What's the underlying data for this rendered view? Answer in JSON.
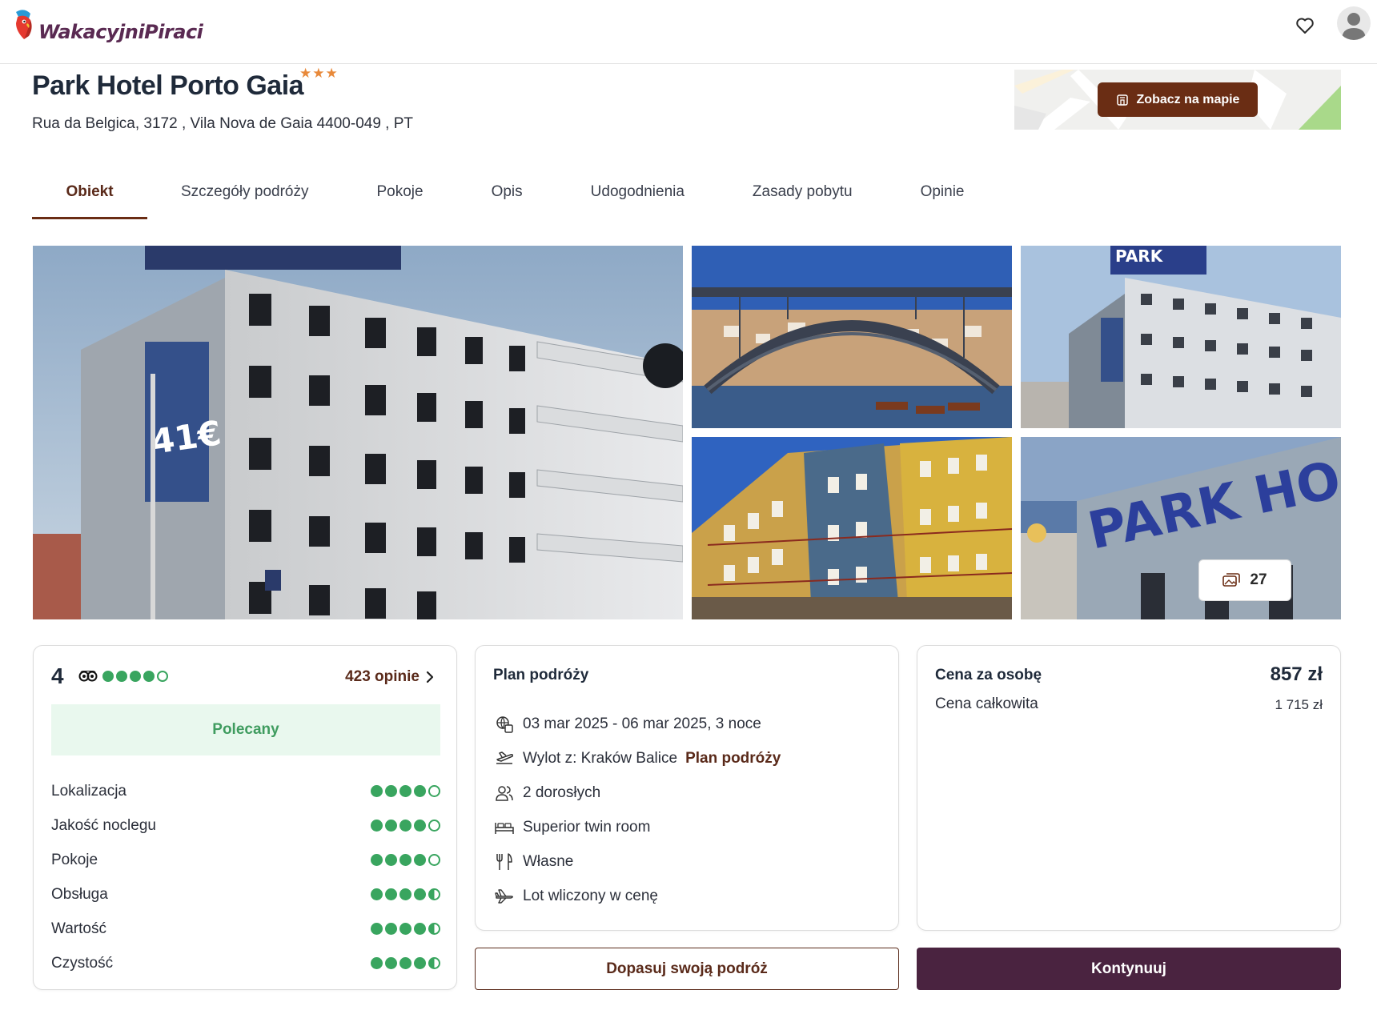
{
  "brand": {
    "name": "WakacyjniPiraci"
  },
  "header": {
    "favorite_icon": "heart-icon",
    "account_icon": "user-icon"
  },
  "hotel": {
    "name": "Park Hotel Porto Gaia",
    "stars_text": "★★★",
    "stars": 3,
    "address": "Rua da Belgica, 3172 , Vila Nova de Gaia 4400-049 , PT",
    "map_button": "Zobacz na mapie"
  },
  "tabs": [
    {
      "label": "Obiekt",
      "active": true
    },
    {
      "label": "Szczegóły podróży"
    },
    {
      "label": "Pokoje"
    },
    {
      "label": "Opis"
    },
    {
      "label": "Udogodnienia"
    },
    {
      "label": "Zasady pobytu"
    },
    {
      "label": "Opinie"
    }
  ],
  "gallery": {
    "photo_count": "27"
  },
  "rating": {
    "score": "4",
    "score_dots": 4,
    "opinions": "423 opinie",
    "badge": "Polecany",
    "criteria": [
      {
        "label": "Lokalizacja",
        "value": 4
      },
      {
        "label": "Jakość noclegu",
        "value": 4
      },
      {
        "label": "Pokoje",
        "value": 4
      },
      {
        "label": "Obsługa",
        "value": 4.5
      },
      {
        "label": "Wartość",
        "value": 4.5
      },
      {
        "label": "Czystość",
        "value": 4.5
      }
    ]
  },
  "plan": {
    "title": "Plan podróży",
    "dates": "03 mar 2025 - 06 mar 2025, 3 noce",
    "departure": "Wylot z: Kraków Balice",
    "departure_link": "Plan podróży",
    "guests": "2 dorosłych",
    "room": "Superior twin room",
    "board": "Własne",
    "flight": "Lot wliczony w cenę"
  },
  "price": {
    "per_person_label": "Cena za osobę",
    "per_person_value": "857 zł",
    "total_label": "Cena całkowita",
    "total_value": "1 715 zł"
  },
  "actions": {
    "adjust": "Dopasuj swoją podróż",
    "continue": "Kontynuuj"
  },
  "colors": {
    "brand_purple": "#4a2340",
    "accent_brown": "#6a2d14",
    "rating_green": "#39a55f",
    "star_orange": "#e8893a"
  }
}
